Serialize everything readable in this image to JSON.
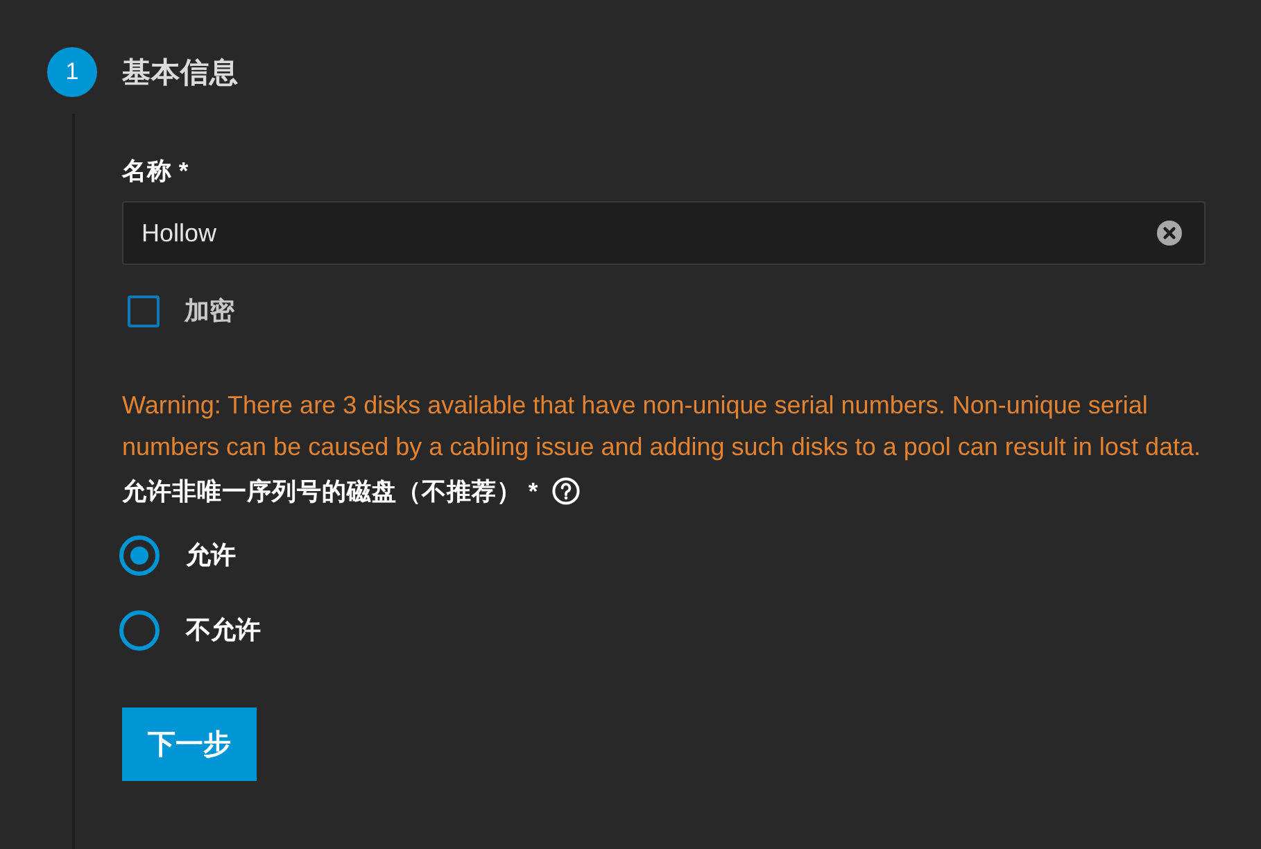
{
  "step": {
    "number": "1",
    "title": "基本信息"
  },
  "name_field": {
    "label": "名称 *",
    "value": "Hollow"
  },
  "encryption": {
    "label": "加密",
    "checked": false
  },
  "warning": "Warning: There are 3 disks available that have non-unique serial numbers. Non-unique serial numbers can be caused by a cabling issue and adding such disks to a pool can result in lost data.",
  "non_unique_serials": {
    "label": "允许非唯一序列号的磁盘（不推荐） *",
    "options": [
      {
        "label": "允许",
        "selected": true
      },
      {
        "label": "不允许",
        "selected": false
      }
    ]
  },
  "buttons": [
    {
      "label": "下一步"
    }
  ]
}
